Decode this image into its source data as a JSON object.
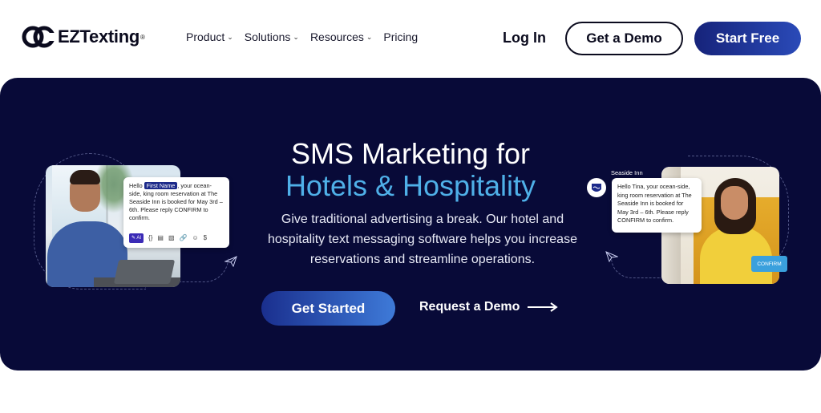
{
  "brand": {
    "logo_text": "EZTexting",
    "reg_mark": "®"
  },
  "nav": {
    "menu": [
      {
        "label": "Product",
        "has_dropdown": true
      },
      {
        "label": "Solutions",
        "has_dropdown": true
      },
      {
        "label": "Resources",
        "has_dropdown": true
      },
      {
        "label": "Pricing",
        "has_dropdown": false
      }
    ],
    "login_label": "Log In",
    "demo_label": "Get a Demo",
    "start_free_label": "Start Free"
  },
  "hero": {
    "title_line1": "SMS Marketing for",
    "title_line2": "Hotels & Hospitality",
    "description": "Give traditional advertising a break. Our hotel and hospitality text messaging software helps you increase reservations and streamline operations.",
    "primary_cta": "Get Started",
    "secondary_cta": "Request a Demo"
  },
  "left_message": {
    "prefix": "Hello ",
    "merge_field": "First Name",
    "body": ", your ocean-side, king room reservation at The Seaside Inn is booked for May 3rd – 6th. Please reply CONFIRM to confirm.",
    "ai_chip": "✎ AI",
    "tools": [
      "{}",
      "▤",
      "▧",
      "🔗",
      "☺",
      "$"
    ]
  },
  "right_message": {
    "sender": "Seaside Inn",
    "text": "Hello Tina, your ocean-side, king room reservation at The Seaside Inn is booked for May 3rd – 6th. Please reply CONFIRM to confirm.",
    "confirm_label": "CONFIRM"
  },
  "colors": {
    "hero_bg": "#080a38",
    "accent_blue": "#4fb0e8",
    "button_gradient_start": "#16237a",
    "button_gradient_end": "#2a4ab8"
  }
}
